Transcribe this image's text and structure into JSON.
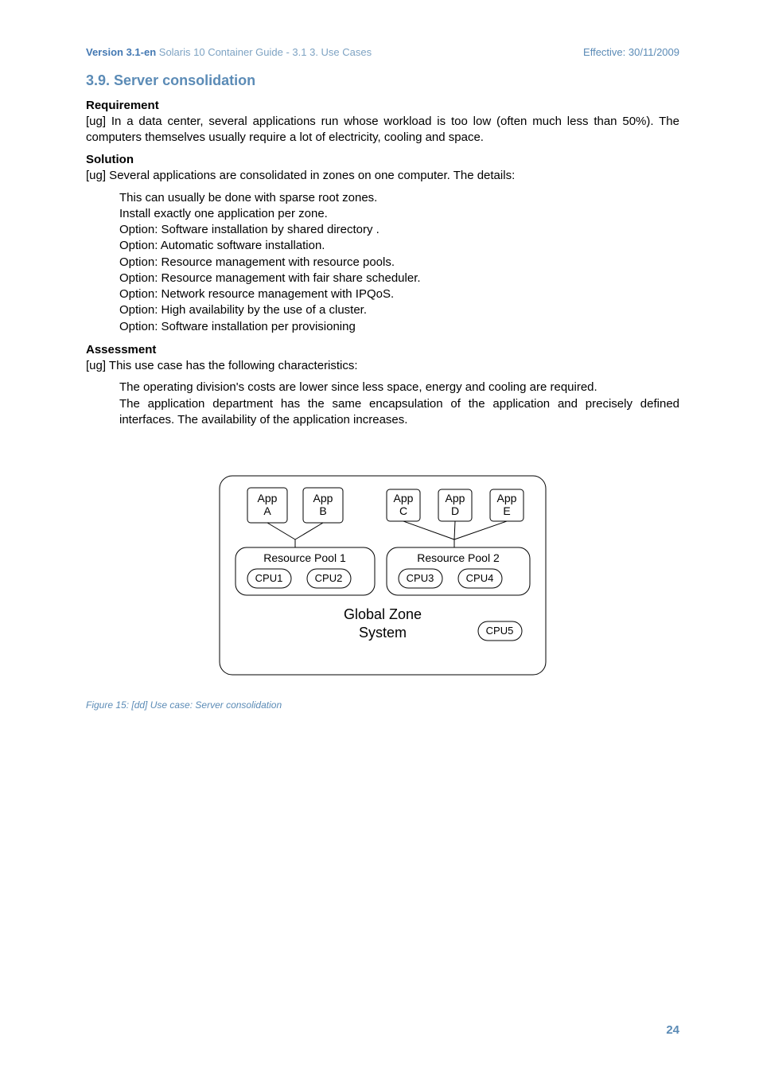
{
  "header": {
    "version": "Version 3.1-en",
    "rest": "  Solaris 10 Container Guide - 3.1   3. Use Cases",
    "right": "Effective: 30/11/2009"
  },
  "section_title": "3.9. Server consolidation",
  "req": {
    "heading": "Requirement",
    "p": "[ug] In a data center, several applications run whose workload is too low (often much less than 50%). The computers themselves usually require a lot of electricity, cooling and space."
  },
  "sol": {
    "heading": "Solution",
    "intro": "[ug] Several applications are consolidated in zones on one computer. The details:",
    "items": [
      "This can usually be done with sparse root zones.",
      "Install exactly one application per zone.",
      "Option: Software installation by shared directory .",
      "Option: Automatic software installation.",
      "Option: Resource management with resource pools.",
      "Option: Resource management with fair share scheduler.",
      "Option: Network resource management with IPQoS.",
      "Option: High availability by the use of a cluster.",
      "Option: Software installation per provisioning"
    ]
  },
  "ass": {
    "heading": "Assessment",
    "intro": "[ug] This use case has the following characteristics:",
    "items": [
      "The operating division's costs are lower since less space, energy and cooling are required.",
      "The application department has the same encapsulation of the application and precisely defined interfaces. The availability of the application increases."
    ]
  },
  "diagram": {
    "apps": [
      "App\nA",
      "App\nB",
      "App\nC",
      "App\nD",
      "App\nE"
    ],
    "pools": [
      "Resource Pool 1",
      "Resource Pool 2"
    ],
    "cpus_pool1": [
      "CPU1",
      "CPU2"
    ],
    "cpus_pool2": [
      "CPU3",
      "CPU4"
    ],
    "gz_line1": "Global Zone",
    "gz_line2": "System",
    "cpu_extra": "CPU5"
  },
  "figure_caption": "Figure 15: [dd] Use case: Server consolidation",
  "page_number": "24"
}
